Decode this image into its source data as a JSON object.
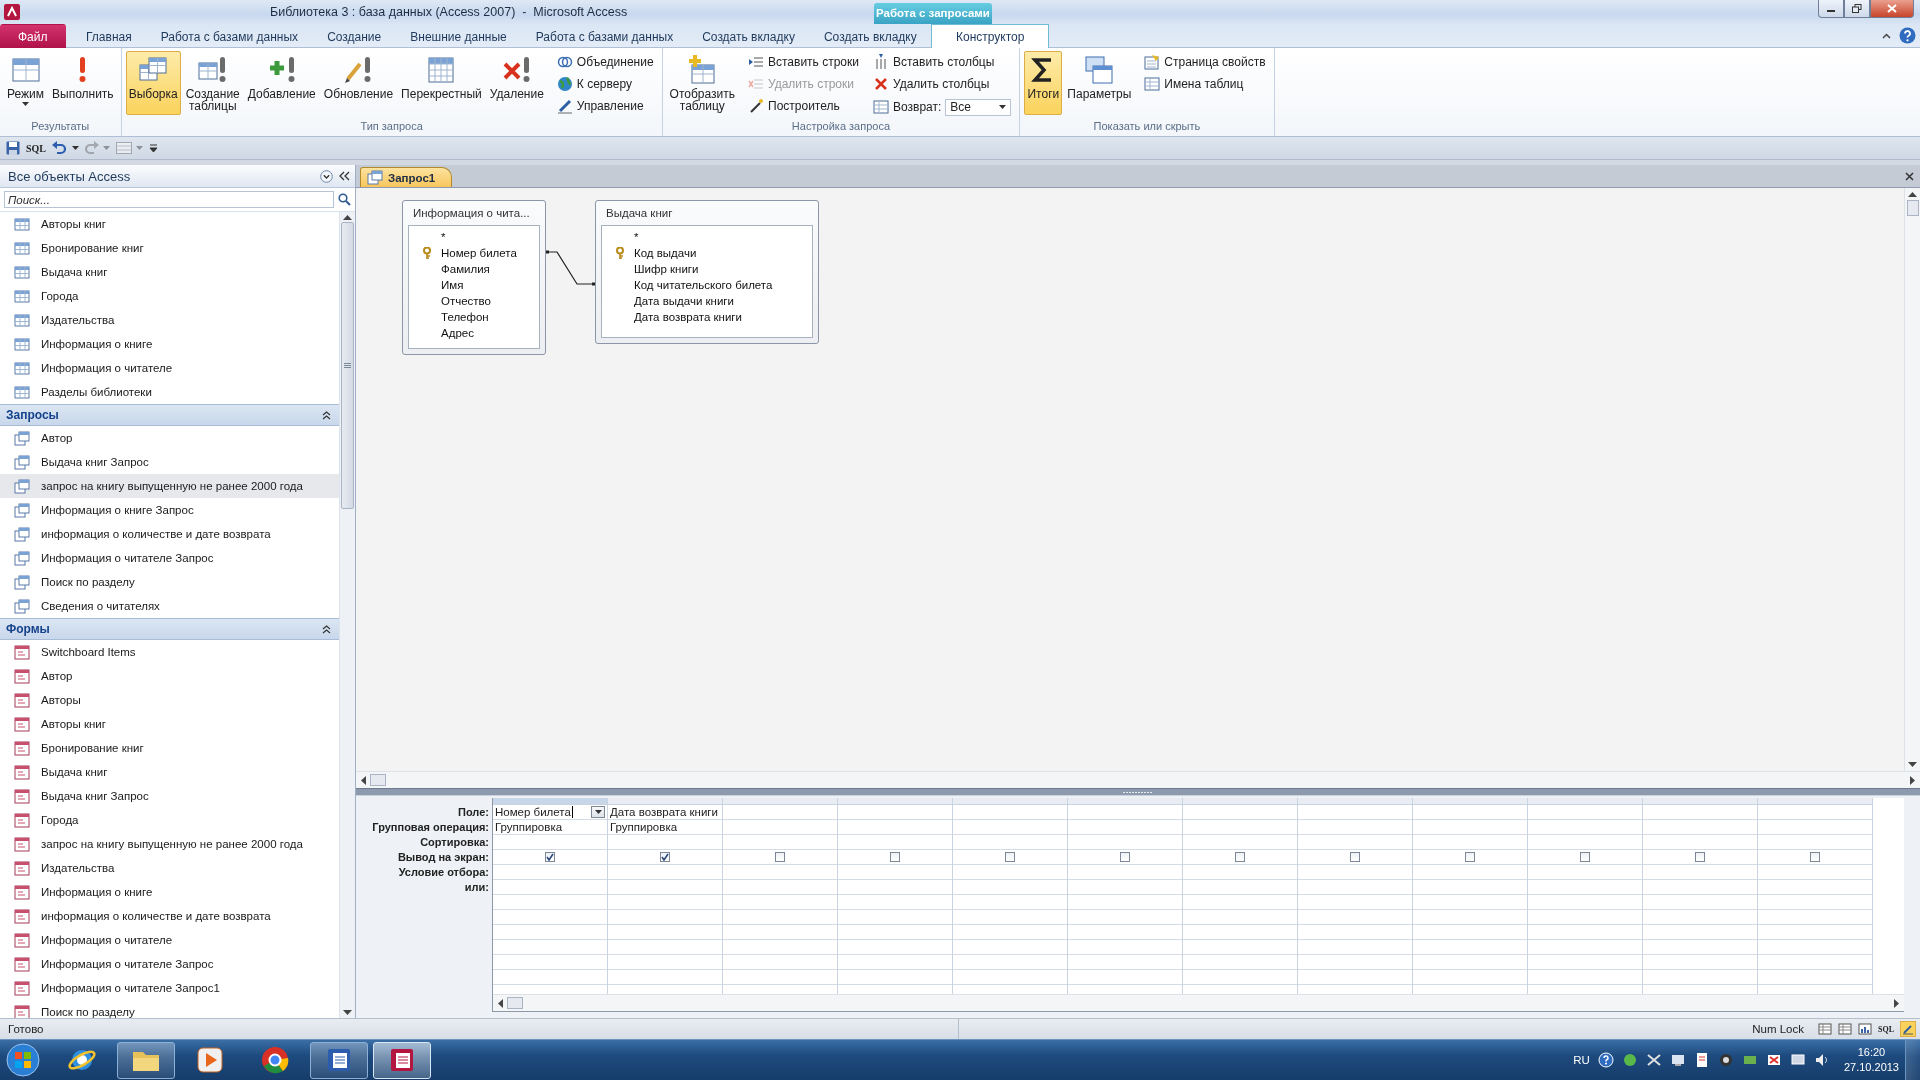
{
  "window": {
    "title": "Библиотека 3 : база данных (Access 2007)  -  Microsoft Access",
    "context_group": "Работа с запросами"
  },
  "ribbon": {
    "tabs": [
      {
        "label": "Файл",
        "kind": "file",
        "selected": false
      },
      {
        "label": "Главная",
        "kind": "tab",
        "selected": false
      },
      {
        "label": "Работа с базами данных",
        "kind": "tab",
        "selected": false
      },
      {
        "label": "Создание",
        "kind": "tab",
        "selected": false
      },
      {
        "label": "Внешние данные",
        "kind": "tab",
        "selected": false
      },
      {
        "label": "Работа с базами данных",
        "kind": "tab",
        "selected": false
      },
      {
        "label": "Создать вкладку",
        "kind": "tab",
        "selected": false
      },
      {
        "label": "Создать вкладку",
        "kind": "tab",
        "selected": false
      },
      {
        "label": "Конструктор",
        "kind": "context",
        "selected": true
      }
    ],
    "groups": [
      {
        "label": "Результаты",
        "controls": [
          {
            "kind": "large",
            "label": "Режим",
            "dropdown": true,
            "selected": false,
            "disabled": false
          },
          {
            "kind": "large",
            "label": "Выполнить",
            "dropdown": false,
            "selected": false,
            "disabled": false
          }
        ]
      },
      {
        "label": "Тип запроса",
        "controls": [
          {
            "kind": "large",
            "label": "Выборка",
            "dropdown": false,
            "selected": true,
            "disabled": false
          },
          {
            "kind": "large",
            "label": "Создание таблицы",
            "dropdown": false,
            "selected": false,
            "disabled": false
          },
          {
            "kind": "large",
            "label": "Добавление",
            "dropdown": false,
            "selected": false,
            "disabled": false
          },
          {
            "kind": "large",
            "label": "Обновление",
            "dropdown": false,
            "selected": false,
            "disabled": false
          },
          {
            "kind": "large",
            "label": "Перекрестный",
            "dropdown": false,
            "selected": false,
            "disabled": false
          },
          {
            "kind": "large",
            "label": "Удаление",
            "dropdown": false,
            "selected": false,
            "disabled": false
          },
          {
            "kind": "small",
            "label": "Объединение",
            "selected": false,
            "disabled": false
          },
          {
            "kind": "small",
            "label": "К серверу",
            "selected": false,
            "disabled": false
          },
          {
            "kind": "small",
            "label": "Управление",
            "selected": false,
            "disabled": false
          }
        ]
      },
      {
        "label": "Настройка запроса",
        "controls": [
          {
            "kind": "large",
            "label": "Отобразить таблицу",
            "dropdown": false,
            "selected": false,
            "disabled": false
          },
          {
            "kind": "small",
            "label": "Вставить строки",
            "selected": false,
            "disabled": false
          },
          {
            "kind": "small",
            "label": "Удалить строки",
            "selected": false,
            "disabled": true
          },
          {
            "kind": "small",
            "label": "Построитель",
            "selected": false,
            "disabled": false
          },
          {
            "kind": "small",
            "label": "Вставить столбцы",
            "selected": false,
            "disabled": false
          },
          {
            "kind": "small",
            "label": "Удалить столбцы",
            "selected": false,
            "disabled": false
          },
          {
            "kind": "combo",
            "label": "Возврат:",
            "value": "Все",
            "selected": false,
            "disabled": false
          }
        ]
      },
      {
        "label": "Показать или скрыть",
        "controls": [
          {
            "kind": "large",
            "label": "Итоги",
            "dropdown": false,
            "selected": true,
            "disabled": false
          },
          {
            "kind": "large",
            "label": "Параметры",
            "dropdown": false,
            "selected": false,
            "disabled": false
          },
          {
            "kind": "small",
            "label": "Страница свойств",
            "selected": false,
            "disabled": false
          },
          {
            "kind": "small",
            "label": "Имена таблиц",
            "selected": false,
            "disabled": false
          }
        ]
      }
    ]
  },
  "quick_access": {
    "sql_label": "SQL"
  },
  "navigation": {
    "title": "Все объекты Access",
    "search": {
      "placeholder": "Поиск..."
    },
    "sections": [
      {
        "kind": "table",
        "items": [
          {
            "label": "Авторы книг",
            "selected": false
          },
          {
            "label": "Бронирование книг",
            "selected": false
          },
          {
            "label": "Выдача книг",
            "selected": false
          },
          {
            "label": "Города",
            "selected": false
          },
          {
            "label": "Издательства",
            "selected": false
          },
          {
            "label": "Информация о книге",
            "selected": false
          },
          {
            "label": "Информация о читателе",
            "selected": false
          },
          {
            "label": "Разделы библиотеки",
            "selected": false
          }
        ]
      },
      {
        "kind": "query",
        "title": "Запросы",
        "expanded": true,
        "items": [
          {
            "label": "Автор",
            "selected": false
          },
          {
            "label": "Выдача книг Запрос",
            "selected": false
          },
          {
            "label": "запрос на книгу выпущенную не ранее 2000 года",
            "selected": true
          },
          {
            "label": "Информация о книге Запрос",
            "selected": false
          },
          {
            "label": "информация о количестве и дате возврата",
            "selected": false
          },
          {
            "label": "Информация о читателе Запрос",
            "selected": false
          },
          {
            "label": "Поиск по разделу",
            "selected": false
          },
          {
            "label": "Сведения о читателях",
            "selected": false
          }
        ]
      },
      {
        "kind": "form",
        "title": "Формы",
        "expanded": true,
        "items": [
          {
            "label": "Switchboard Items",
            "selected": false
          },
          {
            "label": "Автор",
            "selected": false
          },
          {
            "label": "Авторы",
            "selected": false
          },
          {
            "label": "Авторы книг",
            "selected": false
          },
          {
            "label": "Бронирование книг",
            "selected": false
          },
          {
            "label": "Выдача книг",
            "selected": false
          },
          {
            "label": "Выдача книг Запрос",
            "selected": false
          },
          {
            "label": "Города",
            "selected": false
          },
          {
            "label": "запрос на книгу выпущенную не ранее 2000 года",
            "selected": false
          },
          {
            "label": "Издательства",
            "selected": false
          },
          {
            "label": "Информация о книге",
            "selected": false
          },
          {
            "label": "информация о количестве и дате возврата",
            "selected": false
          },
          {
            "label": "Информация о читателе",
            "selected": false
          },
          {
            "label": "Информация о читателе Запрос",
            "selected": false
          },
          {
            "label": "Информация о читателе Запрос1",
            "selected": false
          },
          {
            "label": "Поиск по разделу",
            "selected": false
          }
        ]
      }
    ]
  },
  "document": {
    "tabs": [
      {
        "label": "Запрос1",
        "selected": true
      }
    ],
    "tables": [
      {
        "title": "Информация о чита...",
        "fields": [
          {
            "name": "*",
            "key": false
          },
          {
            "name": "Номер билета",
            "key": true
          },
          {
            "name": "Фамилия",
            "key": false
          },
          {
            "name": "Имя",
            "key": false
          },
          {
            "name": "Отчество",
            "key": false
          },
          {
            "name": "Телефон",
            "key": false
          },
          {
            "name": "Адрес",
            "key": false
          }
        ]
      },
      {
        "title": "Выдача книг",
        "fields": [
          {
            "name": "*",
            "key": false
          },
          {
            "name": "Код выдачи",
            "key": true
          },
          {
            "name": "Шифр книги",
            "key": false
          },
          {
            "name": "Код читательского билета",
            "key": false
          },
          {
            "name": "Дата выдачи книги",
            "key": false
          },
          {
            "name": "Дата возврата книги",
            "key": false
          }
        ]
      }
    ],
    "grid": {
      "row_labels": [
        "Поле:",
        "Групповая операция:",
        "Сортировка:",
        "Вывод на экран:",
        "Условие отбора:",
        "или:"
      ],
      "columns": [
        {
          "field": "Номер билета",
          "total": "Группировка",
          "show": true,
          "active": true
        },
        {
          "field": "Дата возврата книги",
          "total": "Группировка",
          "show": true,
          "active": false
        },
        {
          "show": false,
          "active": false
        },
        {
          "show": false,
          "active": false
        },
        {
          "show": false,
          "active": false
        },
        {
          "show": false,
          "active": false
        },
        {
          "show": false,
          "active": false
        },
        {
          "show": false,
          "active": false
        },
        {
          "show": false,
          "active": false
        },
        {
          "show": false,
          "active": false
        },
        {
          "show": false,
          "active": false
        },
        {
          "show": false,
          "active": false
        }
      ]
    }
  },
  "status_bar": {
    "text": "Готово",
    "num_lock": "Num Lock",
    "sql_view_label": "SQL"
  },
  "taskbar": {
    "language": "RU",
    "time": "16:20",
    "date": "27.10.2013"
  }
}
